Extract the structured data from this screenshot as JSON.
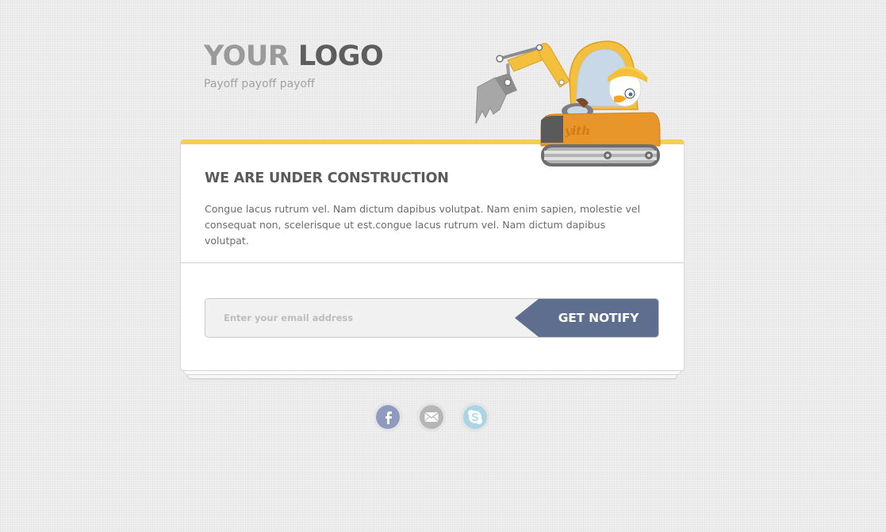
{
  "header": {
    "logo_word_1": "YOUR",
    "logo_word_2": "LOGO",
    "payoff": "Payoff payoff payoff"
  },
  "card": {
    "title": "WE ARE UNDER CONSTRUCTION",
    "text": "Congue lacus rutrum vel. Nam dictum dapibus volutpat. Nam enim sapien, molestie vel consequat non, scelerisque ut est.congue lacus rutrum vel. Nam dictum dapibus volutpat."
  },
  "subscribe": {
    "placeholder": "Enter your email address",
    "button_label": "GET NOTIFY"
  },
  "illustration": {
    "name": "excavator-mascot",
    "body_text": "yith"
  },
  "social": [
    {
      "name": "facebook",
      "icon": "facebook-icon"
    },
    {
      "name": "email",
      "icon": "envelope-icon"
    },
    {
      "name": "skype",
      "icon": "skype-icon"
    }
  ],
  "colors": {
    "accent_yellow": "#f5cf52",
    "button_blue": "#5e6e8f",
    "background": "#efefef",
    "card_background": "#ffffff"
  }
}
